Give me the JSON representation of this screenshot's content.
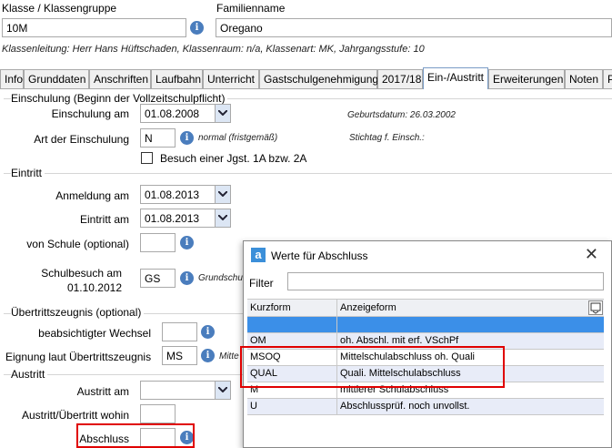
{
  "header": {
    "class_label": "Klasse / Klassengruppe",
    "class_value": "10M",
    "family_label": "Familienname",
    "family_value": "Oregano",
    "info_line": "Klassenleitung: Herr Hans Hüftschaden, Klassenraum: n/a, Klassenart: MK, Jahrgangsstufe: 10"
  },
  "tabs": [
    "Info",
    "Grunddaten",
    "Anschriften",
    "Laufbahn",
    "Unterricht",
    "Gastschulgenehmigung",
    "2017/18",
    "Ein-/Austritt",
    "Erweiterungen",
    "Noten",
    "P"
  ],
  "active_tab": "Ein-/Austritt",
  "einschulung": {
    "section_title": "Einschulung (Beginn der Vollzeitschulpflicht)",
    "einschulung_label": "Einschulung am",
    "einschulung_value": "01.08.2008",
    "geburtsdatum": "Geburtsdatum: 26.03.2002",
    "art_label": "Art der Einschulung",
    "art_value": "N",
    "art_desc": "normal (fristgemäß)",
    "stichtag": "Stichtag f. Einsch.:",
    "checkbox_label": "Besuch einer Jgst. 1A bzw. 2A",
    "checkbox_checked": false
  },
  "eintritt": {
    "section_title": "Eintritt",
    "anmeldung_label": "Anmeldung am",
    "anmeldung_value": "01.08.2013",
    "eintritt_label": "Eintritt am",
    "eintritt_value": "01.08.2013",
    "von_schule_label": "von Schule (optional)",
    "von_schule_value": "",
    "schulbesuch_label_1": "Schulbesuch am",
    "schulbesuch_label_2": "01.10.2012",
    "schulbesuch_value": "GS",
    "schulbesuch_desc": "Grundschu"
  },
  "uebertritt": {
    "section_title": "Übertrittszeugnis (optional)",
    "wechsel_label": "beabsichtigter Wechsel",
    "wechsel_value": "",
    "eignung_label": "Eignung laut Übertrittszeugnis",
    "eignung_value": "MS",
    "eignung_desc": "Mitte"
  },
  "austritt": {
    "section_title": "Austritt",
    "austritt_label": "Austritt am",
    "austritt_value": "",
    "wohin_label": "Austritt/Übertritt wohin",
    "wohin_value": "",
    "abschluss_label": "Abschluss",
    "abschluss_value": ""
  },
  "dialog": {
    "title": "Werte für Abschluss",
    "close": "✕",
    "filter_label": "Filter",
    "filter_value": "",
    "col_kurzform": "Kurzform",
    "col_anzeigeform": "Anzeigeform",
    "rows": [
      {
        "kurz": "",
        "anzeige": ""
      },
      {
        "kurz": "OM",
        "anzeige": "oh. Abschl. mit erf. VSchPf"
      },
      {
        "kurz": "MSOQ",
        "anzeige": "Mittelschulabschluss oh. Quali"
      },
      {
        "kurz": "QUAL",
        "anzeige": "Quali. Mittelschulabschluss"
      },
      {
        "kurz": "M",
        "anzeige": "mittlerer Schulabschluss"
      },
      {
        "kurz": "U",
        "anzeige": "Abschlussprüf. noch unvollst."
      }
    ]
  },
  "colors": {
    "accent": "#4a7dbd",
    "selected_row": "#3b8fe8",
    "highlight": "#e00000"
  }
}
